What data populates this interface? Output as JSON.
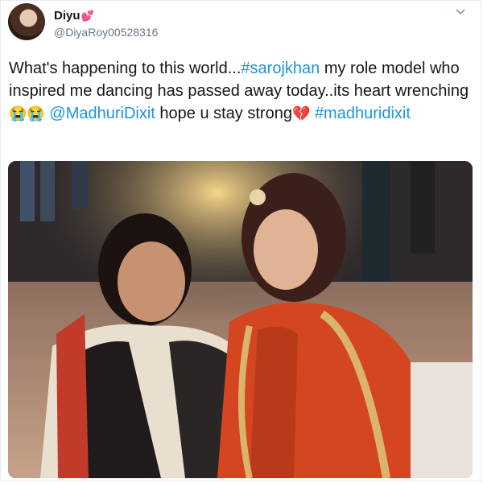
{
  "tweet": {
    "author_name": "Diyu",
    "author_name_emoji": "💕",
    "handle": "@DiyaRoy00528316",
    "text_part1": "What's happening to this world...",
    "hashtag1": "#sarojkhan",
    "text_part2": " my role model who inspired me dancing has passed away today..its heart wrenching",
    "crying_emojis": "😭😭",
    "mention": "@MadhuriDixit",
    "text_part3": " hope u stay strong",
    "broken_heart": "💔",
    "hashtag2": "#madhuridixit"
  },
  "colors": {
    "link": "#1b95e0",
    "text": "#14171a",
    "secondary": "#657786"
  },
  "icons": {
    "menu": "chevron-down-icon",
    "avatar": "avatar"
  }
}
